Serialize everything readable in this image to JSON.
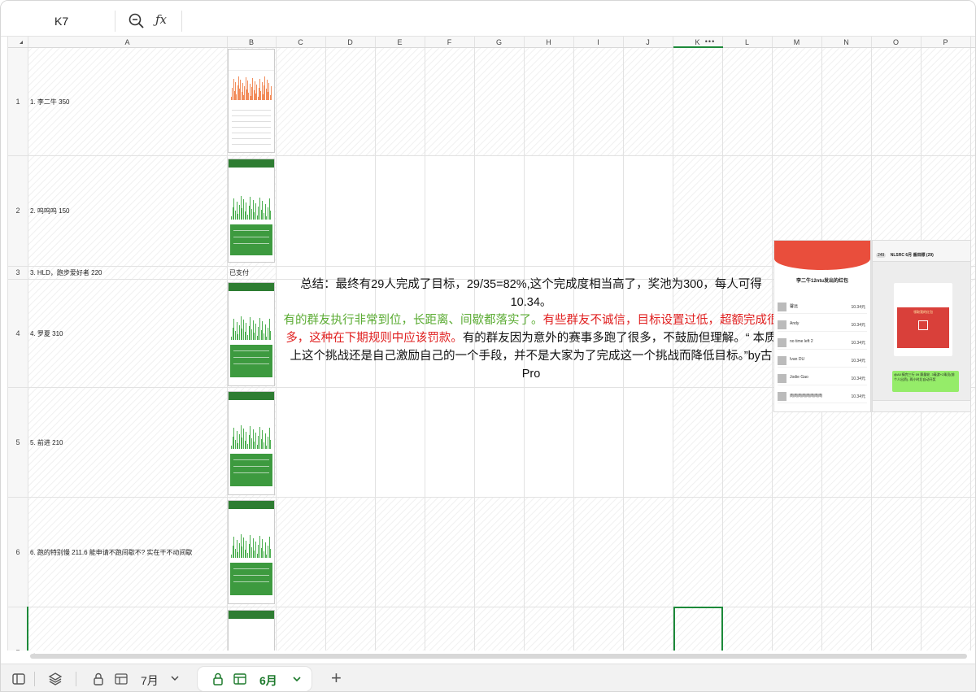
{
  "formula_bar": {
    "cell_reference": "K7",
    "fx_label": "ƒx"
  },
  "columns": [
    "A",
    "B",
    "C",
    "D",
    "E",
    "F",
    "G",
    "H",
    "I",
    "J",
    "K",
    "L",
    "M",
    "N",
    "O",
    "P"
  ],
  "active_column_menu": "•••",
  "rows": [
    {
      "number": "1",
      "a": "1. 李二牛 350",
      "b": ""
    },
    {
      "number": "2",
      "a": "2. 呜呜呜 150",
      "b": ""
    },
    {
      "number": "3",
      "a": "3. HLD，跑步爱好者 220",
      "b": "已支付"
    },
    {
      "number": "4",
      "a": "4. 罗夏 310",
      "b": ""
    },
    {
      "number": "5",
      "a": "5. 前进  210",
      "b": ""
    },
    {
      "number": "6",
      "a": "6. 跑的特别慢 211.6 能申请不跑间歇不? 实在干不动间歇",
      "b": ""
    },
    {
      "number": "7",
      "a": "",
      "b": ""
    }
  ],
  "summary": {
    "line1": "总结：最终有29人完成了目标，29/35=82%,这个完成度相当高了，奖池为300，每人可得10.34。",
    "green": "有的群友执行非常到位，长距离、间歇都落实了。",
    "red": "有些群友不诚信，目标设置过低，超额完成很多，这种在下期规则中应该罚款。",
    "rest": "有的群友因为意外的赛事多跑了很多，不鼓励但理解。“ 本质上这个挑战还是自己激励自己的一个手段，并不是大家为了完成这一个挑战而降低目标。”by古Pro"
  },
  "red_packet": {
    "title": "李二牛12ntu发出的红包",
    "rows": [
      {
        "name": "馨远",
        "amount": "10.34元"
      },
      {
        "name": "Andy",
        "amount": "10.34元"
      },
      {
        "name": "no time left 2",
        "amount": "10.34元"
      },
      {
        "name": "Ivan DU",
        "amount": "10.34元"
      },
      {
        "name": "Jodie Gao",
        "amount": "10.34元"
      },
      {
        "name": "両両両両両両両両",
        "amount": "10.34元"
      }
    ]
  },
  "chat": {
    "title": "NLSRC 6月 番田標 (29)",
    "badge": "249",
    "card_title": "领取我的红包",
    "my_message": "@All 搞完三行 09 赛量轮, 3毫游+2乘员(前个人出资), 两小时后自动开奖"
  },
  "sheet_tabs": {
    "inactive": "7月",
    "active": "6月",
    "add": "+"
  },
  "colors": {
    "accent_green": "#1d7a2c",
    "summary_green": "#5aab32",
    "summary_red": "#e02020",
    "wechat_red": "#e94e3c"
  }
}
